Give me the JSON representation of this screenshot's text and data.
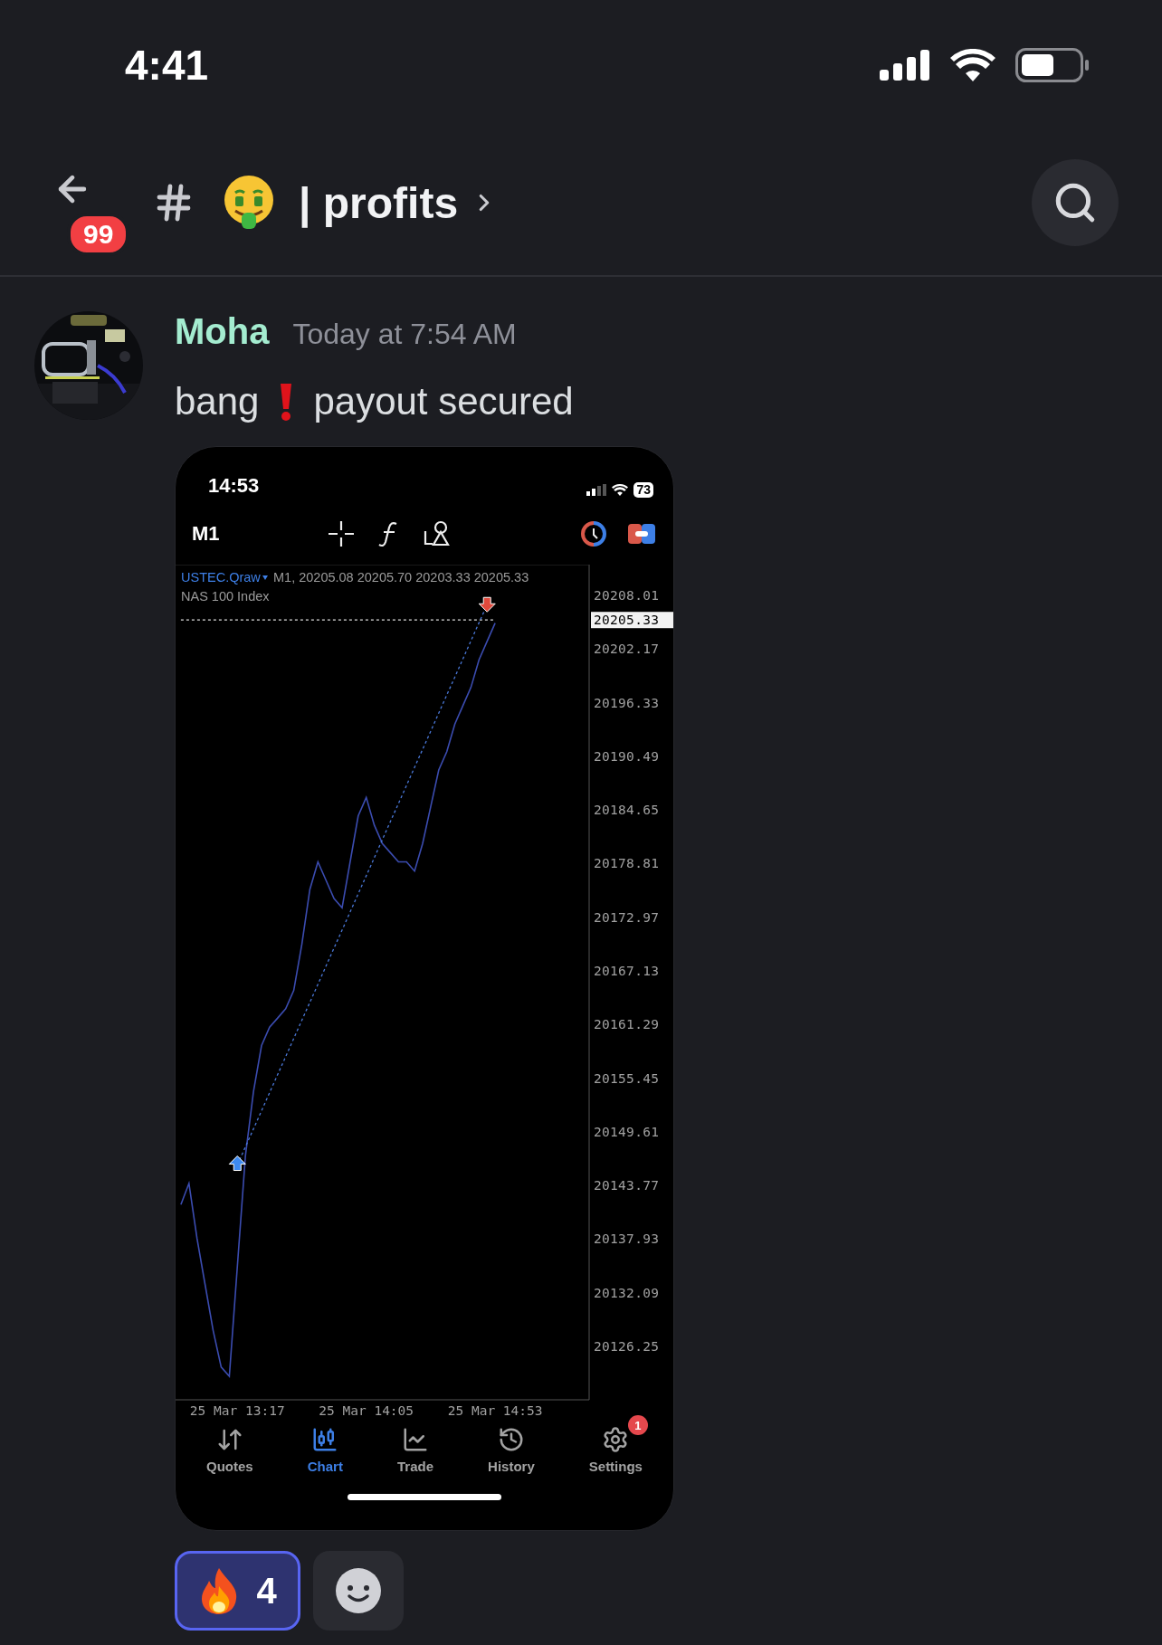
{
  "status_bar": {
    "time": "4:41"
  },
  "header": {
    "unread_badge": "99",
    "channel_name": "| profits"
  },
  "message": {
    "author": "Moha",
    "timestamp": "Today at 7:54 AM",
    "text_before": "bang",
    "text_after": "payout secured",
    "attachment": {
      "status_bar": {
        "time": "14:53",
        "battery": "73"
      },
      "toolbar": {
        "timeframe": "M1"
      },
      "current_price": "20205.33",
      "chart_header": {
        "quote": "M1, 20205.08 20205.70 20203.33 20205.33",
        "description": "NAS 100 Index"
      },
      "chart_data": {
        "type": "line",
        "categories": [
          null,
          null,
          null,
          null,
          null,
          null,
          null,
          "25 Mar 13:17",
          null,
          null,
          null,
          null,
          null,
          null,
          null,
          null,
          null,
          null,
          null,
          null,
          null,
          null,
          null,
          "25 Mar 14:05",
          null,
          null,
          null,
          null,
          null,
          null,
          null,
          null,
          null,
          null,
          null,
          null,
          null,
          null,
          null,
          "25 Mar 14:53"
        ],
        "series": [
          {
            "name": "USTEC.Qraw",
            "color": "#3b4cb0",
            "values": [
              20141.7,
              20144,
              20138,
              20133,
              20128,
              20124,
              20123,
              20135,
              20147,
              20154,
              20159,
              20161,
              20162,
              20163,
              20165,
              20170,
              20176,
              20179,
              20177,
              20175,
              20174,
              20179,
              20184,
              20186,
              20183,
              20181,
              20180,
              20179,
              20179,
              20178,
              20181,
              20185,
              20189,
              20191,
              20194,
              20196,
              20198,
              20201,
              20203,
              20205
            ]
          },
          {
            "color": "#dddddd",
            "line_style": "dashed",
            "values": [
              20205.33,
              20205.33,
              20205.33,
              20205.33,
              20205.33,
              20205.33,
              20205.33,
              20205.33,
              20205.33,
              20205.33,
              20205.33,
              20205.33,
              20205.33,
              20205.33,
              20205.33,
              20205.33,
              20205.33,
              20205.33,
              20205.33,
              20205.33,
              20205.33,
              20205.33,
              20205.33,
              20205.33,
              20205.33,
              20205.33,
              20205.33,
              20205.33,
              20205.33,
              20205.33,
              20205.33,
              20205.33,
              20205.33,
              20205.33,
              20205.33,
              20205.33,
              20205.33,
              20205.33,
              20205.33,
              20205.33
            ]
          },
          {
            "color": "#4a78d8",
            "line_style": "dashed",
            "marker": "triangle",
            "values": [
              null,
              null,
              null,
              null,
              null,
              null,
              null,
              20146,
              null,
              null,
              null,
              null,
              null,
              null,
              null,
              null,
              null,
              null,
              null,
              null,
              null,
              null,
              null,
              null,
              null,
              null,
              null,
              null,
              null,
              null,
              null,
              null,
              null,
              null,
              null,
              null,
              null,
              null,
              20207,
              null
            ]
          }
        ],
        "ylim": [
          20120.44,
          20211.36
        ],
        "yticks": [
          20208.01,
          20202.17,
          20196.33,
          20190.49,
          20184.65,
          20178.81,
          20172.97,
          20167.13,
          20161.29,
          20155.45,
          20149.61,
          20143.77,
          20137.93,
          20132.09,
          20126.25
        ]
      },
      "nav": [
        {
          "kind": "quotes",
          "label": "Quotes",
          "selected": false
        },
        {
          "kind": "chart",
          "label": "Chart",
          "selected": true
        },
        {
          "kind": "trade",
          "label": "Trade",
          "selected": false
        },
        {
          "kind": "history",
          "label": "History",
          "selected": false
        },
        {
          "kind": "settings",
          "label": "Settings",
          "selected": false,
          "badge": "1"
        }
      ]
    }
  },
  "reactions": [
    {
      "kind": "fire",
      "count": "4",
      "selected": true
    }
  ]
}
